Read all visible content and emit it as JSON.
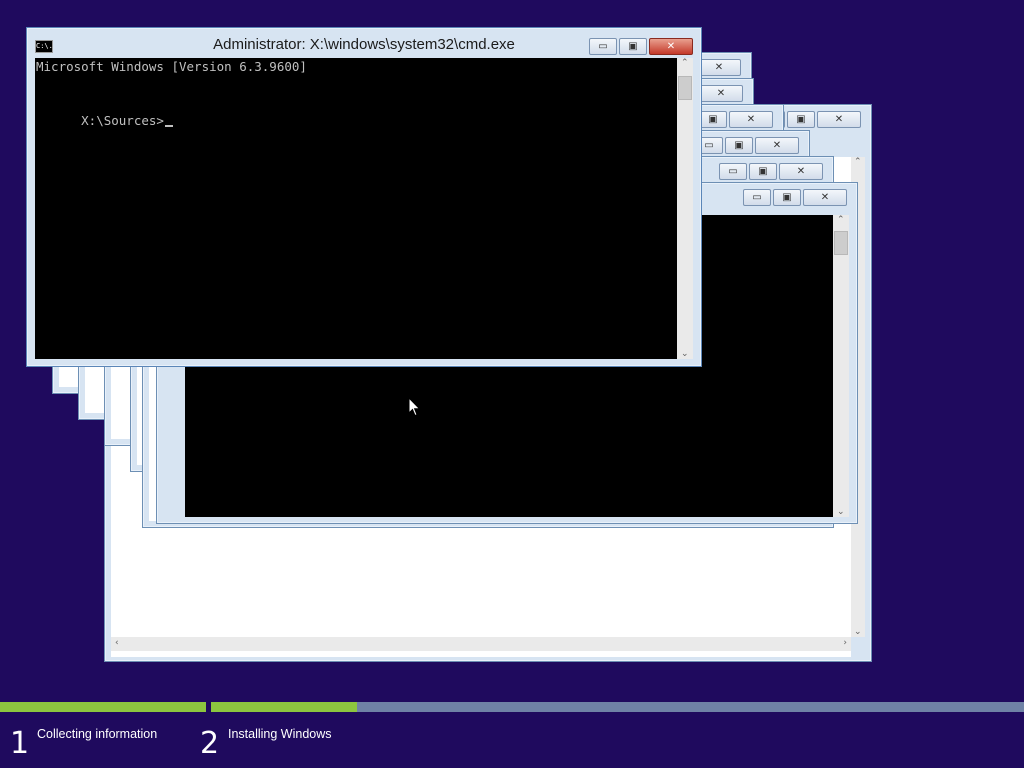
{
  "window": {
    "title": "Administrator: X:\\windows\\system32\\cmd.exe",
    "icon_text": "C:\\.",
    "minimize_glyph": "▭",
    "maximize_glyph": "▣",
    "close_glyph": "✕",
    "console_lines": [
      "Microsoft Windows [Version 6.3.9600]",
      "",
      "X:\\Sources>"
    ]
  },
  "icons": {
    "scroll_up": "⌃",
    "scroll_down": "⌄",
    "scroll_left": "‹",
    "scroll_right": "›"
  },
  "setup": {
    "progress_step1": 1.0,
    "progress_step2": 0.18,
    "steps": [
      {
        "number": "1",
        "label": "Collecting information"
      },
      {
        "number": "2",
        "label": "Installing Windows"
      }
    ]
  },
  "colors": {
    "desktop": "#1f0a5e",
    "progress_fill": "#8cc63f",
    "progress_track": "#6f82a6",
    "close_button": "#c4392a"
  }
}
